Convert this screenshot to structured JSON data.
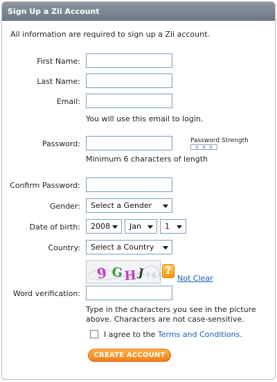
{
  "header": {
    "title": "Sign Up a Zii Account"
  },
  "intro": "All information are required to sign up a Zii account.",
  "fields": {
    "first_name": {
      "label": "First Name:",
      "value": ""
    },
    "last_name": {
      "label": "Last Name:",
      "value": ""
    },
    "email": {
      "label": "Email:",
      "value": "",
      "note": "You will use this email to login."
    },
    "password": {
      "label": "Password:",
      "value": "",
      "note": "Minimum 6 characters of length",
      "strength_label": "Password Strength"
    },
    "confirm_password": {
      "label": "Confirm Password:",
      "value": ""
    },
    "gender": {
      "label": "Gender:",
      "selected": "Select a Gender"
    },
    "dob": {
      "label": "Date of birth:",
      "year": "2008",
      "month": "Jan",
      "day": "1"
    },
    "country": {
      "label": "Country:",
      "selected": "Select a Country"
    },
    "word_verification": {
      "label": "Word verification:",
      "value": "",
      "captcha_text": "9GHJ",
      "not_clear": "Not Clear",
      "note": "Type in the characters you see in the picture above. Characters are not case-sensitive."
    }
  },
  "agree": {
    "prefix": "I agree to the ",
    "link": "Terms and Conditions",
    "suffix": "."
  },
  "button": {
    "label": "CREATE ACCOUNT"
  },
  "colors": {
    "accent": "#F07D14",
    "link": "#1A5FB4",
    "header": "#7A8390"
  },
  "icons": {
    "help": "question-mark-icon"
  }
}
